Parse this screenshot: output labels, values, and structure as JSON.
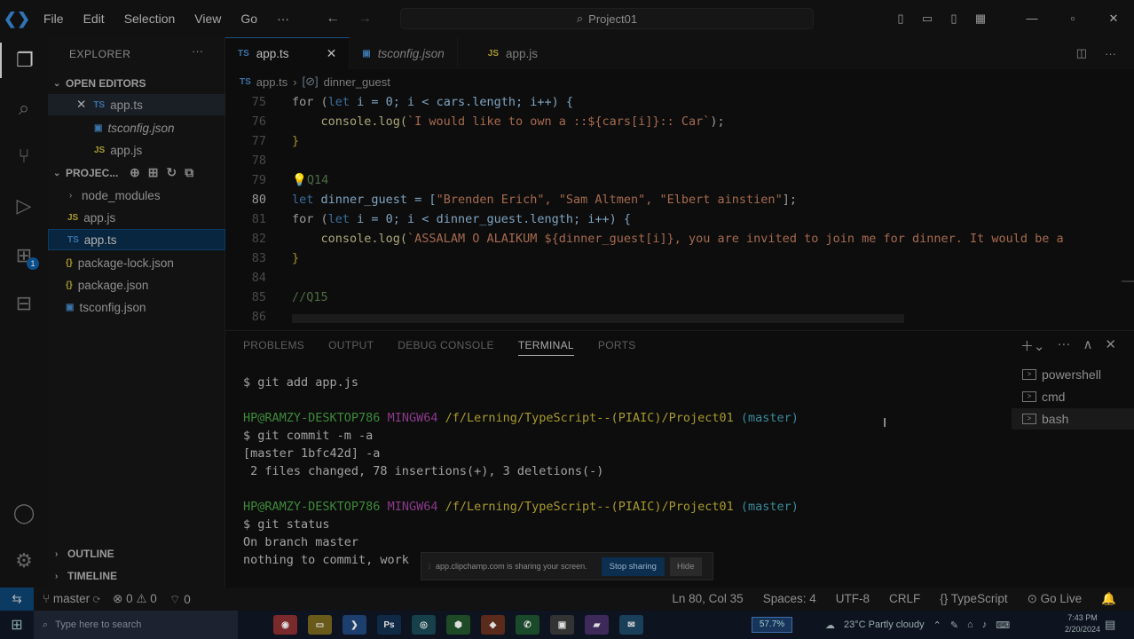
{
  "titlebar": {
    "menu": [
      "File",
      "Edit",
      "Selection",
      "View",
      "Go",
      "···"
    ],
    "search": "Project01"
  },
  "sidebar": {
    "title": "EXPLORER",
    "open_editors_label": "OPEN EDITORS",
    "open_editors": [
      {
        "name": "app.ts",
        "type": "TS"
      },
      {
        "name": "tsconfig.json",
        "type": "TS"
      },
      {
        "name": "app.js",
        "type": "JS"
      }
    ],
    "project_label": "PROJEC...",
    "files": [
      {
        "name": "node_modules",
        "type": "folder"
      },
      {
        "name": "app.js",
        "type": "JS"
      },
      {
        "name": "app.ts",
        "type": "TS"
      },
      {
        "name": "package-lock.json",
        "type": "{}"
      },
      {
        "name": "package.json",
        "type": "{}"
      },
      {
        "name": "tsconfig.json",
        "type": "TS"
      }
    ],
    "outline_label": "OUTLINE",
    "timeline_label": "TIMELINE"
  },
  "tabs": [
    {
      "label": "app.ts",
      "type": "TS"
    },
    {
      "label": "tsconfig.json",
      "type": "TS"
    },
    {
      "label": "app.js",
      "type": "JS"
    }
  ],
  "breadcrumb": {
    "file": "app.ts",
    "symbol": "dinner_guest"
  },
  "editor": {
    "line_numbers": [
      "75",
      "76",
      "77",
      "78",
      "79",
      "80",
      "81",
      "82",
      "83",
      "84",
      "85",
      "86"
    ],
    "lines": {
      "l75_a": "for (",
      "l75_kw": "let",
      "l75_b": " i = 0; i < cars.length; i++) {",
      "l76_a": "    console.log(",
      "l76_str": "`I would like to own a ::${cars[i]}:: Car`",
      "l76_b": ");",
      "l77": "}",
      "l79": "Q14",
      "l80_kw": "let",
      "l80_a": " dinner_guest = [",
      "l80_str": "\"Brenden Erich\", \"Sam Altmen\", \"Elbert ainstien\"",
      "l80_b": "];",
      "l81_a": "for (",
      "l81_kw": "let",
      "l81_b": " i = 0; i < dinner_guest.length; i++) {",
      "l82_a": "    console.log(",
      "l82_str": "`ASSALAM O ALAIKUM ${dinner_guest[i]}, you are invited to join me for dinner. It would be a",
      "l83": "}",
      "l85": "//Q15"
    }
  },
  "panel": {
    "tabs": [
      "PROBLEMS",
      "OUTPUT",
      "DEBUG CONSOLE",
      "TERMINAL",
      "PORTS"
    ],
    "terminal": {
      "l1": "$ git add app.js",
      "prompt_user": "HP@RAMZY-DESKTOP786",
      "prompt_sys": "MINGW64",
      "prompt_path": "/f/Lerning/TypeScript--(PIAIC)/Project01",
      "prompt_branch": "(master)",
      "l3": "$ git commit -m -a",
      "l4": "[master 1bfc42d] -a",
      "l5": " 2 files changed, 78 insertions(+), 3 deletions(-)",
      "l7": "$ git status",
      "l8": "On branch master",
      "l9": "nothing to commit, work"
    },
    "terminals": [
      "powershell",
      "cmd",
      "bash"
    ]
  },
  "share_banner": {
    "text": "app.clipchamp.com is sharing your screen.",
    "stop": "Stop sharing",
    "hide": "Hide"
  },
  "statusbar": {
    "branch": "master",
    "errors": "0",
    "warnings": "0",
    "ports": "0",
    "position": "Ln 80, Col 35",
    "spaces": "Spaces: 4",
    "encoding": "UTF-8",
    "eol": "CRLF",
    "language": "TypeScript",
    "golive": "Go Live"
  },
  "taskbar": {
    "search_placeholder": "Type here to search",
    "battery": "57.7%",
    "weather": "23°C  Partly cloudy",
    "time": "7:43 PM",
    "date": "2/20/2024"
  }
}
